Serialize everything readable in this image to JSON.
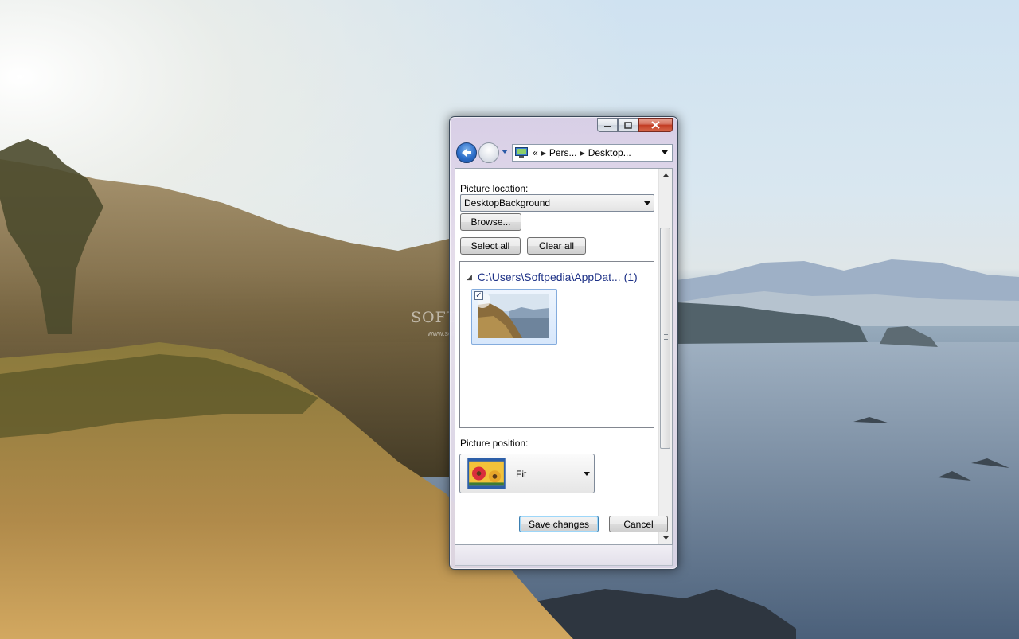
{
  "window": {
    "address": {
      "overflow_chevrons": "«",
      "crumbs": [
        "Pers...",
        "Desktop..."
      ]
    },
    "picture_location": {
      "label": "Picture location:",
      "selected": "DesktopBackground",
      "browse_label": "Browse..."
    },
    "select_all_label": "Select all",
    "clear_all_label": "Clear all",
    "group": {
      "title": "C:\\Users\\Softpedia\\AppDat...",
      "count": "(1)"
    },
    "picture_position": {
      "label": "Picture position:",
      "selected": "Fit"
    },
    "save_label": "Save changes",
    "cancel_label": "Cancel"
  },
  "watermark": {
    "text": "SOFTPEDIA",
    "url": "www.softpedia.com"
  },
  "colors": {
    "title_close": "#c23b22",
    "group_link": "#1e3287",
    "selection_border": "#84acdd"
  }
}
